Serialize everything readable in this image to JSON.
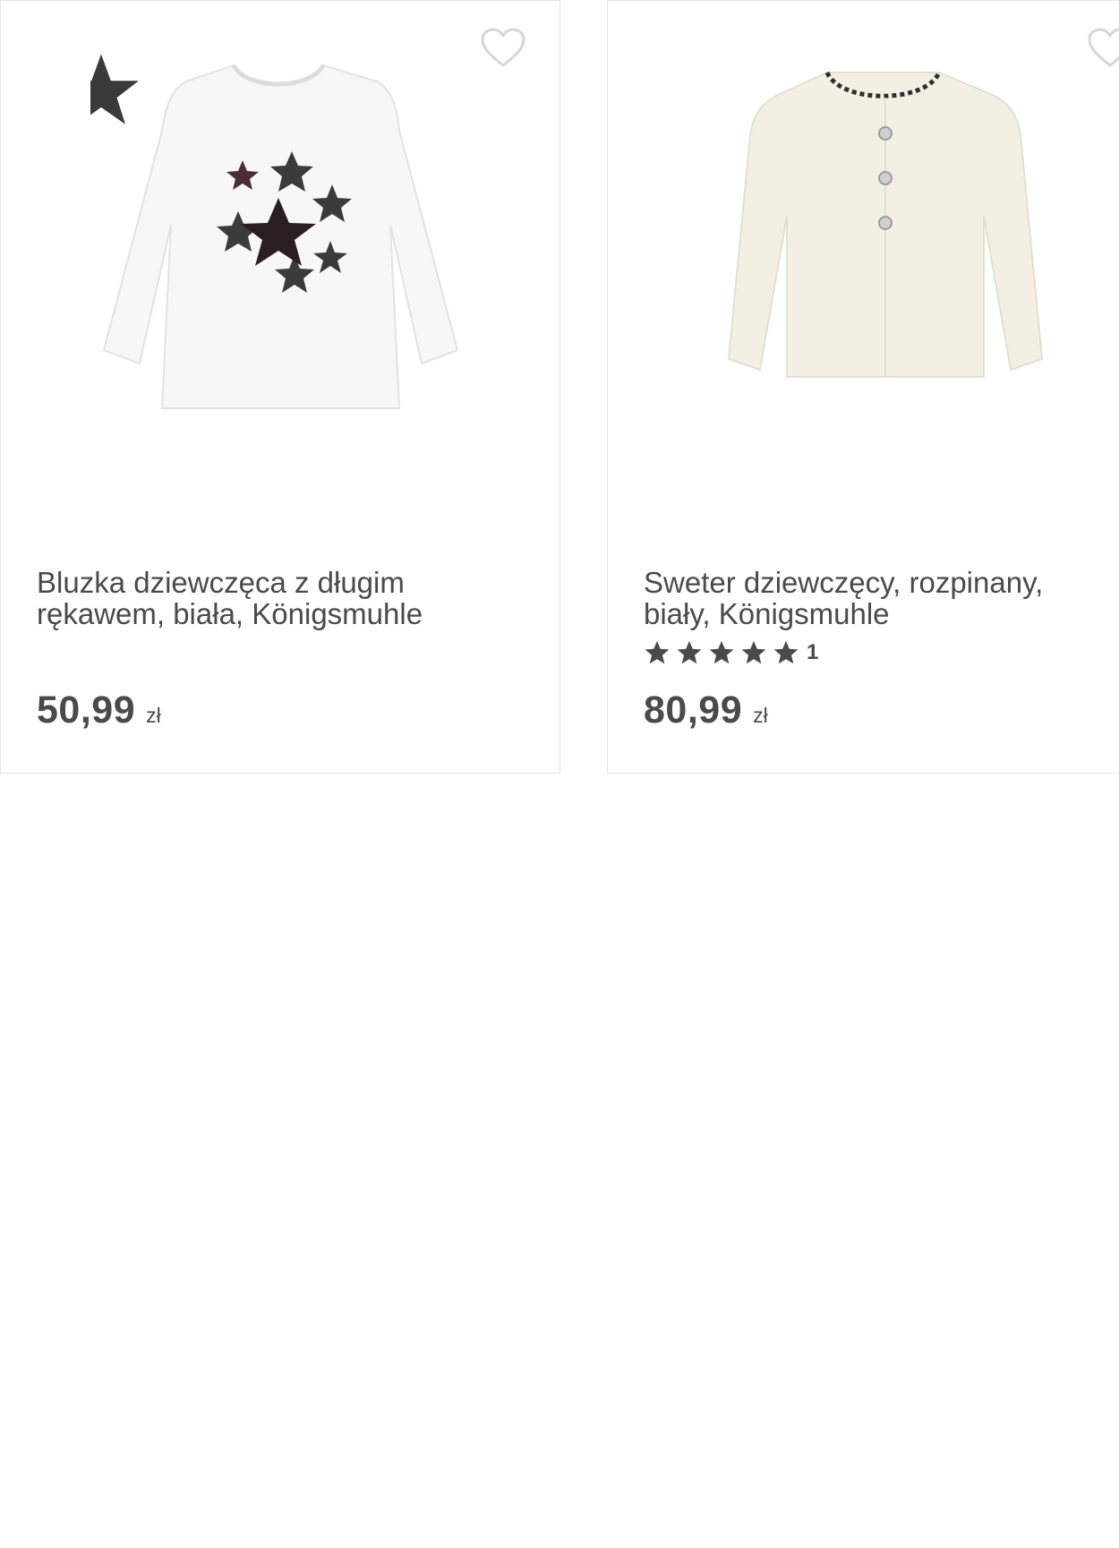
{
  "products": [
    {
      "title_line1": "Bluzka dziewczęca z długim",
      "title_line2": "rękawem, biała, Königsmuhle",
      "price_amount": "50,99",
      "price_currency": "zł"
    },
    {
      "title_line1": "Sweter dziewczęcy, rozpinany,",
      "title_line2": "biały, Königsmuhle",
      "rating_stars": 5,
      "rating_count": "1",
      "price_amount": "80,99",
      "price_currency": "zł"
    }
  ],
  "icons": {
    "favorite": "heart-outline-icon",
    "rating": "star-icon"
  },
  "colors": {
    "text": "#4a4a4a",
    "icon_outline": "#d6d6d6",
    "border": "#e3e3e3"
  }
}
